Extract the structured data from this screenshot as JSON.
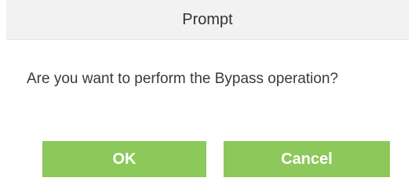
{
  "dialog": {
    "title": "Prompt",
    "message": "Are you want to perform the Bypass operation?",
    "ok_label": "OK",
    "cancel_label": "Cancel"
  },
  "colors": {
    "header_background": "#f2f2f2",
    "button_background": "#8cc85a",
    "button_text": "#ffffff",
    "message_text": "#3a3a3a"
  }
}
